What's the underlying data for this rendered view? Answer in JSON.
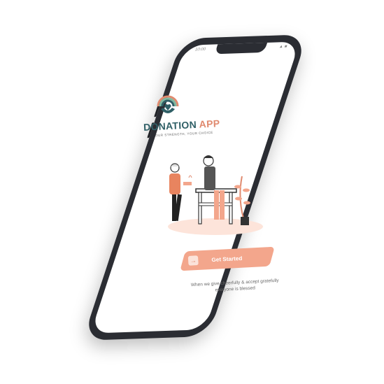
{
  "status": {
    "time": "10:00",
    "icons": "▲ ■"
  },
  "app": {
    "name_part1": "DONATION",
    "name_part2": " APP",
    "tagline": "OUR STRENGTH, YOUR CHOICE"
  },
  "cta": {
    "label": "Get Started",
    "icon": "→"
  },
  "quote": "When we give cheerfully & accept gratefully everyone is blessed",
  "colors": {
    "accent": "#f3a68c",
    "brand_dark": "#2f5f66",
    "brand_orange": "#e08a6f",
    "phone_body": "#2b2d33"
  }
}
